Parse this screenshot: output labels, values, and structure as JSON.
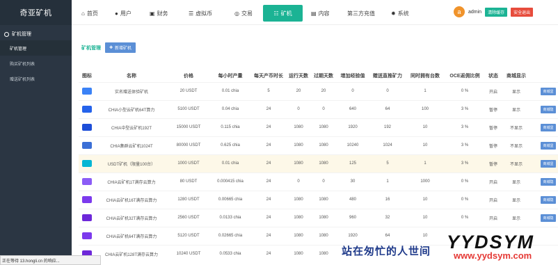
{
  "app": {
    "brand": "奇亚矿机"
  },
  "sidebar": {
    "group": "矿机管理",
    "items": [
      {
        "label": "矿机管理"
      },
      {
        "label": "购买矿机列表"
      },
      {
        "label": "赠送矿机列表"
      }
    ]
  },
  "nav": {
    "tabs": [
      {
        "label": "首页",
        "icon": "home-icon"
      },
      {
        "label": "用户",
        "icon": "user-icon"
      },
      {
        "label": "财务",
        "icon": "finance-icon"
      },
      {
        "label": "虚拟币",
        "icon": "coin-icon"
      },
      {
        "label": "交易",
        "icon": "trade-icon"
      },
      {
        "label": "矿机",
        "icon": "list-icon"
      },
      {
        "label": "内容",
        "icon": "content-icon"
      },
      {
        "label": "第三方充值",
        "icon": ""
      },
      {
        "label": "系统",
        "icon": "gear-icon"
      }
    ],
    "avatar_letter": "a",
    "username": "admin",
    "clear_cache": "清除缓存",
    "logout": "安全退出"
  },
  "page": {
    "title": "矿机管理",
    "add_button": "新增矿机"
  },
  "table": {
    "columns": [
      "图标",
      "名称",
      "价格",
      "每小时产量",
      "每天产币时长",
      "运行天数",
      "过期天数",
      "增加经验值",
      "赠送直推矿力",
      "同时拥有台数",
      "OCE返佣比例",
      "状态",
      "商城显示",
      ""
    ],
    "rows": [
      {
        "name": "实名赠送体验矿机",
        "price": "20 USDT",
        "hourly": "0.01 chia",
        "daily_hours": "5",
        "run_days": "20",
        "expire_days": "20",
        "exp": "0",
        "referral_power": "0",
        "max_owned": "1",
        "oce": "0 %",
        "status": "开启",
        "mall": "显示",
        "action": "商城显",
        "icon_color": "#3b82f6"
      },
      {
        "name": "CHIA小型云矿机64T算力",
        "price": "5100 USDT",
        "hourly": "0.04 chia",
        "daily_hours": "24",
        "run_days": "0",
        "expire_days": "0",
        "exp": "640",
        "referral_power": "64",
        "max_owned": "100",
        "oce": "3 %",
        "status": "暂停",
        "mall": "显示",
        "action": "商城隐",
        "icon_color": "#2563eb"
      },
      {
        "name": "CHIA中型云矿机192T",
        "price": "15000 USDT",
        "hourly": "0.115 chia",
        "daily_hours": "24",
        "run_days": "1080",
        "expire_days": "1080",
        "exp": "1920",
        "referral_power": "192",
        "max_owned": "10",
        "oce": "3 %",
        "status": "暂停",
        "mall": "不显示",
        "action": "商城显",
        "icon_color": "#1d4ed8"
      },
      {
        "name": "CHIA集群云矿机1024T",
        "price": "80000 USDT",
        "hourly": "0.625 chia",
        "daily_hours": "24",
        "run_days": "1080",
        "expire_days": "1080",
        "exp": "10240",
        "referral_power": "1024",
        "max_owned": "10",
        "oce": "3 %",
        "status": "暂停",
        "mall": "不显示",
        "action": "商城显",
        "icon_color": "#3b6fd6"
      },
      {
        "name": "USDT矿机（限量100台）",
        "price": "1000 USDT",
        "hourly": "0.01 chia",
        "daily_hours": "24",
        "run_days": "1080",
        "expire_days": "1080",
        "exp": "125",
        "referral_power": "5",
        "max_owned": "1",
        "oce": "3 %",
        "status": "暂停",
        "mall": "不显示",
        "action": "商城显",
        "icon_color": "#06b6d4"
      },
      {
        "name": "CHIA云矿机1T满存云算力",
        "price": "80 USDT",
        "hourly": "0.000415 chia",
        "daily_hours": "24",
        "run_days": "0",
        "expire_days": "0",
        "exp": "30",
        "referral_power": "1",
        "max_owned": "1000",
        "oce": "0 %",
        "status": "开启",
        "mall": "显示",
        "action": "商城隐",
        "icon_color": "#8b5cf6"
      },
      {
        "name": "CHIA云矿机16T满存云算力",
        "price": "1280 USDT",
        "hourly": "0.00665 chia",
        "daily_hours": "24",
        "run_days": "1080",
        "expire_days": "1080",
        "exp": "480",
        "referral_power": "16",
        "max_owned": "10",
        "oce": "0 %",
        "status": "开启",
        "mall": "显示",
        "action": "商城隐",
        "icon_color": "#7c3aed"
      },
      {
        "name": "CHIA云矿机32T满存云算力",
        "price": "2560 USDT",
        "hourly": "0.0133 chia",
        "daily_hours": "24",
        "run_days": "1080",
        "expire_days": "1080",
        "exp": "960",
        "referral_power": "32",
        "max_owned": "10",
        "oce": "0 %",
        "status": "开启",
        "mall": "显示",
        "action": "商城隐",
        "icon_color": "#6d28d9"
      },
      {
        "name": "CHIA云矿机64T满存云算力",
        "price": "5120 USDT",
        "hourly": "0.02665 chia",
        "daily_hours": "24",
        "run_days": "1080",
        "expire_days": "1080",
        "exp": "1920",
        "referral_power": "64",
        "max_owned": "10",
        "oce": "",
        "status": "",
        "mall": "",
        "action": "",
        "icon_color": "#7c3aed"
      },
      {
        "name": "CHIA云矿机128T满存云算力",
        "price": "10240 USDT",
        "hourly": "0.0533 chia",
        "daily_hours": "24",
        "run_days": "1080",
        "expire_days": "1080",
        "exp": "",
        "referral_power": "",
        "max_owned": "",
        "oce": "",
        "status": "",
        "mall": "",
        "action": "",
        "icon_color": "#6d28d9"
      }
    ]
  },
  "statusbar": {
    "text": "正在等待 13.hongli.cn 的响应..."
  },
  "watermark": {
    "cn": "站在匆忙的人世间",
    "brand": "YYDSYM",
    "url": "www.yydsym.com"
  }
}
